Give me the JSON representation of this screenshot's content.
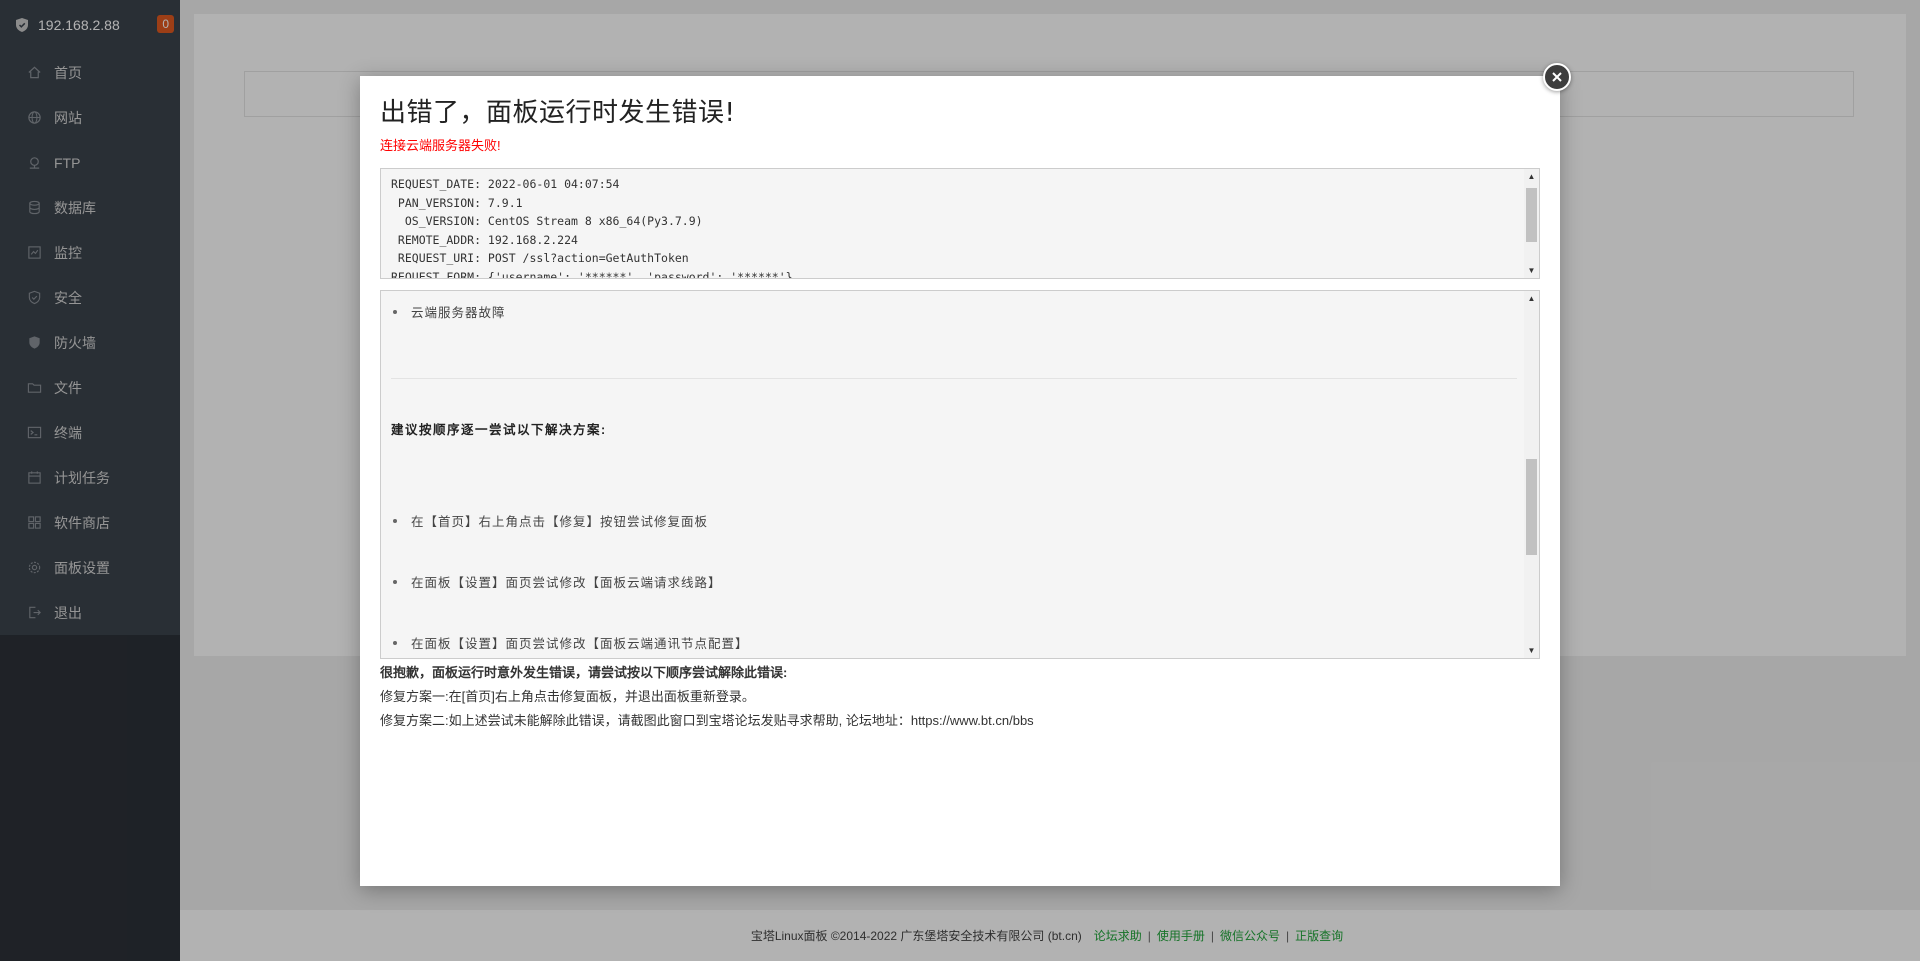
{
  "sidebar": {
    "host": "192.168.2.88",
    "badge": "0",
    "items": [
      {
        "label": "首页",
        "icon": "home-icon"
      },
      {
        "label": "网站",
        "icon": "globe-icon"
      },
      {
        "label": "FTP",
        "icon": "ftp-icon"
      },
      {
        "label": "数据库",
        "icon": "database-icon"
      },
      {
        "label": "监控",
        "icon": "monitor-icon"
      },
      {
        "label": "安全",
        "icon": "shield-check-icon"
      },
      {
        "label": "防火墙",
        "icon": "firewall-icon"
      },
      {
        "label": "文件",
        "icon": "folder-icon"
      },
      {
        "label": "终端",
        "icon": "terminal-icon"
      },
      {
        "label": "计划任务",
        "icon": "calendar-icon"
      },
      {
        "label": "软件商店",
        "icon": "apps-icon"
      },
      {
        "label": "面板设置",
        "icon": "gear-icon"
      },
      {
        "label": "退出",
        "icon": "logout-icon"
      }
    ]
  },
  "modal": {
    "title": "出错了，面板运行时发生错误!",
    "subtitle": "连接云端服务器失败!",
    "log_lines": [
      "REQUEST_DATE: 2022-06-01 04:07:54",
      " PAN_VERSION: 7.9.1",
      "  OS_VERSION: CentOS Stream 8 x86_64(Py3.7.9)",
      " REMOTE_ADDR: 192.168.2.224",
      " REQUEST_URI: POST /ssl?action=GetAuthToken",
      "REQUEST_FORM: {'username': '******', 'password': '******'}"
    ],
    "detail": {
      "cause": "云端服务器故障",
      "heading": "建议按顺序逐一尝试以下解决方案:",
      "solutions": [
        "在【首页】右上角点击【修复】按钮尝试修复面板",
        "在面板【设置】面页尝试修改【面板云端请求线路】",
        "在面板【设置】面页尝试修改【面板云端通讯节点配置】"
      ]
    },
    "notes": {
      "line1": "很抱歉，面板运行时意外发生错误，请尝试按以下顺序尝试解除此错误:",
      "line2": "修复方案一:在[首页]右上角点击修复面板，并退出面板重新登录。",
      "line3": "修复方案二:如上述尝试未能解除此错误，请截图此窗口到宝塔论坛发贴寻求帮助, 论坛地址：https://www.bt.cn/bbs"
    }
  },
  "footer": {
    "copyright": "宝塔Linux面板 ©2014-2022 广东堡塔安全技术有限公司 (bt.cn)",
    "links": [
      "论坛求助",
      "使用手册",
      "微信公众号",
      "正版查询"
    ],
    "separator": "|"
  },
  "colors": {
    "sidebar_bg": "#3c444d",
    "accent_green": "#20a53a",
    "error_red": "#ff0000",
    "badge_orange": "#e05a20"
  }
}
